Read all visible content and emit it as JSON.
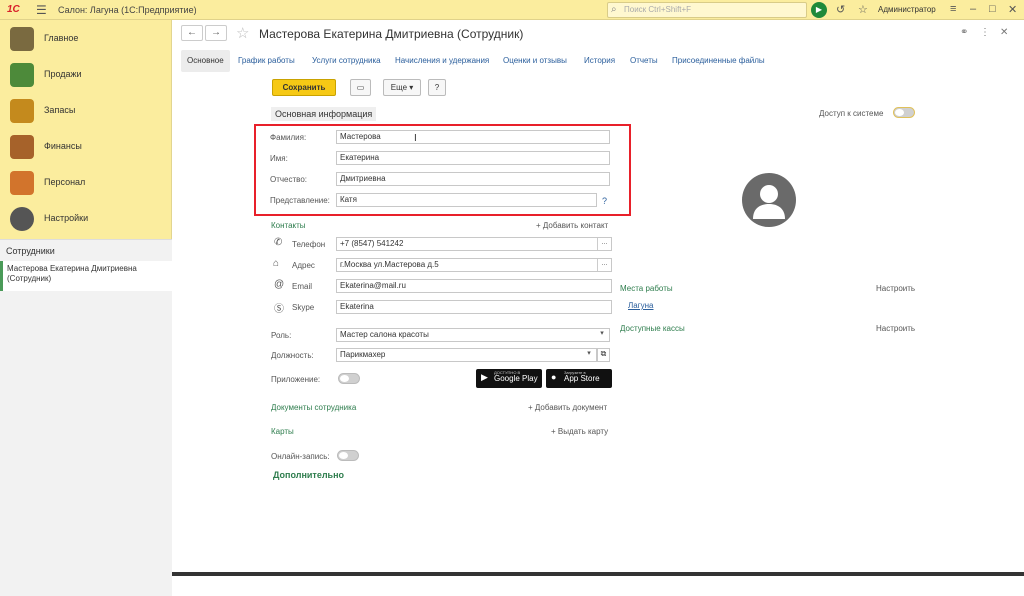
{
  "titlebar": {
    "logo": "1С",
    "menu_icon": "hamburger-icon",
    "title": "Салон: Лагуна  (1С:Предприятие)",
    "search_placeholder": "Поиск Ctrl+Shift+F",
    "user": "Администратор",
    "window_controls": [
      "minimize-icon",
      "maximize-icon",
      "close-icon"
    ]
  },
  "sidebar": {
    "items": [
      {
        "label": "Главное",
        "icon": "main-icon",
        "color": "#7a6a40"
      },
      {
        "label": "Продажи",
        "icon": "sales-chart-icon",
        "color": "#4d8a3a"
      },
      {
        "label": "Запасы",
        "icon": "stock-icon",
        "color": "#c48a1d"
      },
      {
        "label": "Финансы",
        "icon": "wallet-icon",
        "color": "#a6622a"
      },
      {
        "label": "Персонал",
        "icon": "people-icon",
        "color": "#d2742c"
      },
      {
        "label": "Настройки",
        "icon": "gear-icon",
        "color": "#555555"
      }
    ],
    "section_title": "Сотрудники",
    "open_item": "Мастерова Екатерина Дмитриевна (Сотрудник)"
  },
  "header": {
    "title": "Мастерова Екатерина Дмитриевна (Сотрудник)",
    "back_icon": "arrow-left-icon",
    "forward_icon": "arrow-right-icon",
    "star_icon": "star-icon"
  },
  "tabs": [
    "Основное",
    "График работы",
    "Услуги сотрудника",
    "Начисления и удержания",
    "Оценки и отзывы",
    "История",
    "Отчеты",
    "Присоединенные файлы"
  ],
  "toolbar": {
    "save": "Сохранить",
    "more": "Еще",
    "help": "?"
  },
  "basic": {
    "title": "Основная информация",
    "access_label": "Доступ к системе",
    "fields": [
      {
        "label": "Фамилия:",
        "value": "Мастерова"
      },
      {
        "label": "Имя:",
        "value": "Екатерина"
      },
      {
        "label": "Отчество:",
        "value": "Дмитриевна"
      },
      {
        "label": "Представление:",
        "value": "Катя"
      }
    ],
    "help": "?"
  },
  "contacts": {
    "title": "Контакты",
    "add": "+ Добавить контакт",
    "items": [
      {
        "icon": "phone-icon",
        "label": "Телефон",
        "value": "+7 (8547) 541242"
      },
      {
        "icon": "home-icon",
        "label": "Адрес",
        "value": "г.Москва ул.Мастерова д.5"
      },
      {
        "icon": "at-icon",
        "label": "Email",
        "value": "Ekaterina@mail.ru"
      },
      {
        "icon": "skype-icon",
        "label": "Skype",
        "value": "Ekaterina"
      }
    ]
  },
  "role": {
    "label": "Роль:",
    "value": "Мастер салона красоты"
  },
  "position": {
    "label": "Должность:",
    "value": "Парикмахер"
  },
  "app": {
    "label": "Приложение:",
    "google": "Google Play",
    "google_small": "ДОСТУПНО В",
    "apple": "App Store",
    "apple_small": "Загрузите в"
  },
  "docs": {
    "title": "Документы сотрудника",
    "add": "+ Добавить документ"
  },
  "cards": {
    "title": "Карты",
    "add": "+ Выдать карту"
  },
  "online": {
    "label": "Онлайн-запись:"
  },
  "extra": {
    "title": "Дополнительно"
  },
  "workplaces": {
    "title": "Места работы",
    "configure": "Настроить",
    "item": "Лагуна"
  },
  "cashboxes": {
    "title": "Доступные кассы",
    "configure": "Настроить"
  }
}
